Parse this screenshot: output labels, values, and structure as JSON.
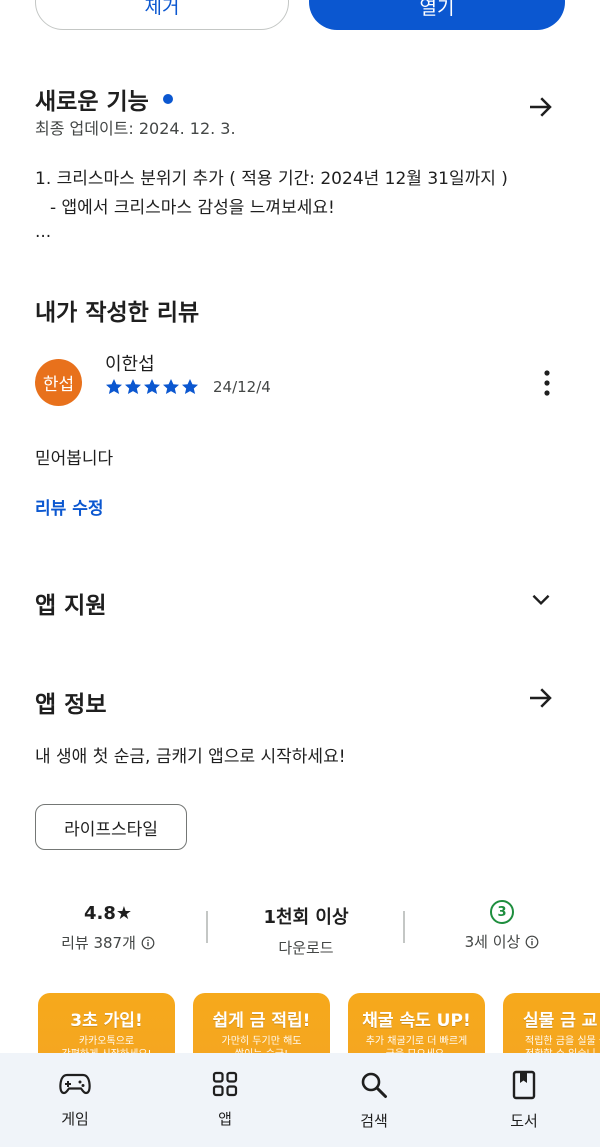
{
  "top_buttons": {
    "remove": "제거",
    "open": "열기"
  },
  "whats_new": {
    "title": "새로운 기능",
    "updated": "최종 업데이트: 2024. 12. 3.",
    "lines": [
      "1. 크리스마스 분위기 추가 ( 적용 기간: 2024년 12월 31일까지 )",
      "- 앱에서 크리스마스 감성을 느껴보세요!",
      "..."
    ]
  },
  "my_review": {
    "title": "내가 작성한 리뷰",
    "avatar_text": "한섭",
    "user_name": "이한섭",
    "stars": 5,
    "date": "24/12/4",
    "text": "믿어봅니다",
    "edit_link": "리뷰 수정"
  },
  "app_support": {
    "title": "앱 지원"
  },
  "app_info": {
    "title": "앱 정보",
    "description": "내 생애 첫 순금, 금캐기 앱으로 시작하세요!",
    "category_chip": "라이프스타일"
  },
  "stats": {
    "rating": "4.8★",
    "rating_label": "리뷰 387개",
    "downloads": "1천회 이상",
    "downloads_label": "다운로드",
    "age_badge": "3",
    "age_label": "3세 이상"
  },
  "screenshots": [
    {
      "title": "3초 가입!",
      "sub1": "카카오톡으로",
      "sub2": "간편하게 시작하세요!"
    },
    {
      "title": "쉽게 금 적립!",
      "sub1": "가만히 두기만 해도",
      "sub2": "쌓이는 순금!"
    },
    {
      "title": "채굴 속도 UP!",
      "sub1": "추가 채굴기로 더 빠르게",
      "sub2": "금을 모으세요."
    },
    {
      "title": "실물 금 교",
      "sub1": "적립한 금을 실물 금",
      "sub2": "전환할 수 있습니"
    }
  ],
  "bottom_nav": {
    "games": "게임",
    "apps": "앱",
    "search": "검색",
    "books": "도서"
  },
  "colors": {
    "accent": "#0b57d0",
    "avatar": "#e8711c",
    "age_badge": "#1e8e3e",
    "card": "#f6a91b"
  }
}
